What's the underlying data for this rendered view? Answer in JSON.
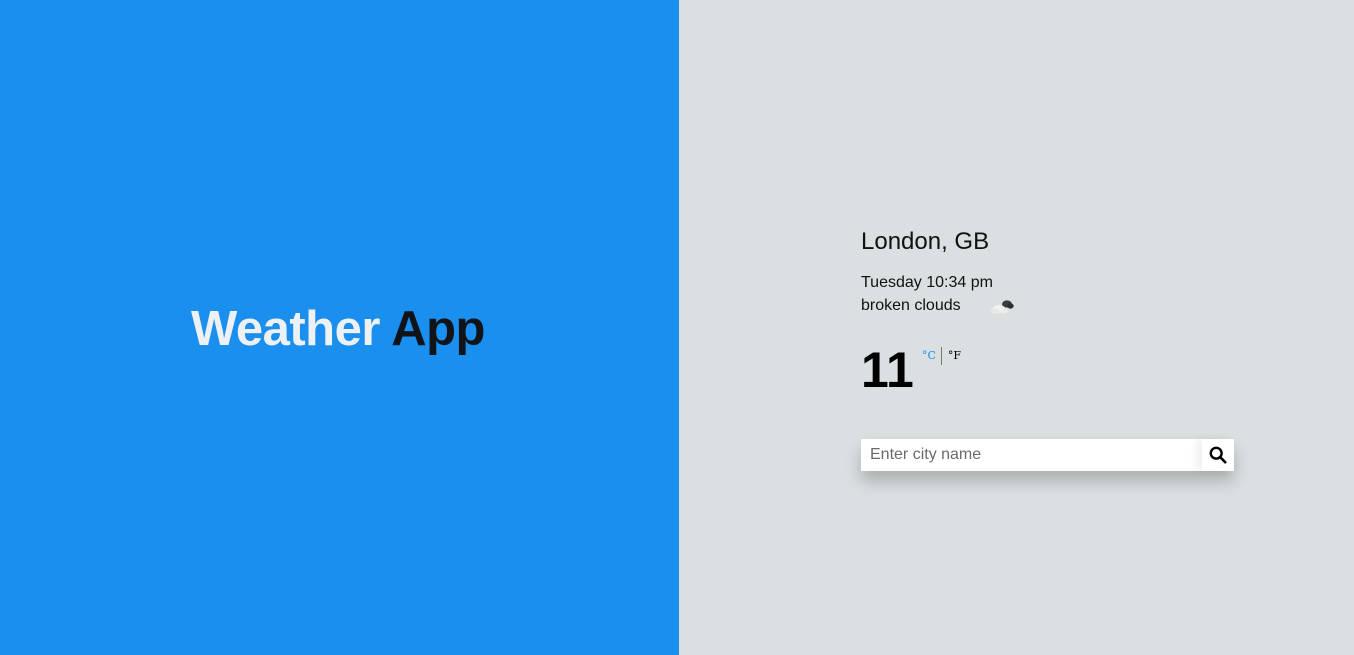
{
  "brand": {
    "title_part1": "Weather",
    "title_part2": "App"
  },
  "weather": {
    "location": "London, GB",
    "datetime": "Tuesday 10:34 pm",
    "description": "broken clouds",
    "icon": "broken-clouds-icon",
    "temperature": "11",
    "unit_celsius": "°C",
    "unit_fahrenheit": "°F",
    "active_unit": "celsius"
  },
  "search": {
    "placeholder": "Enter city name",
    "value": "",
    "icon": "search-icon"
  },
  "colors": {
    "left_panel": "#1a8fee",
    "right_panel": "#dadfe1",
    "accent": "#1a8fee"
  }
}
